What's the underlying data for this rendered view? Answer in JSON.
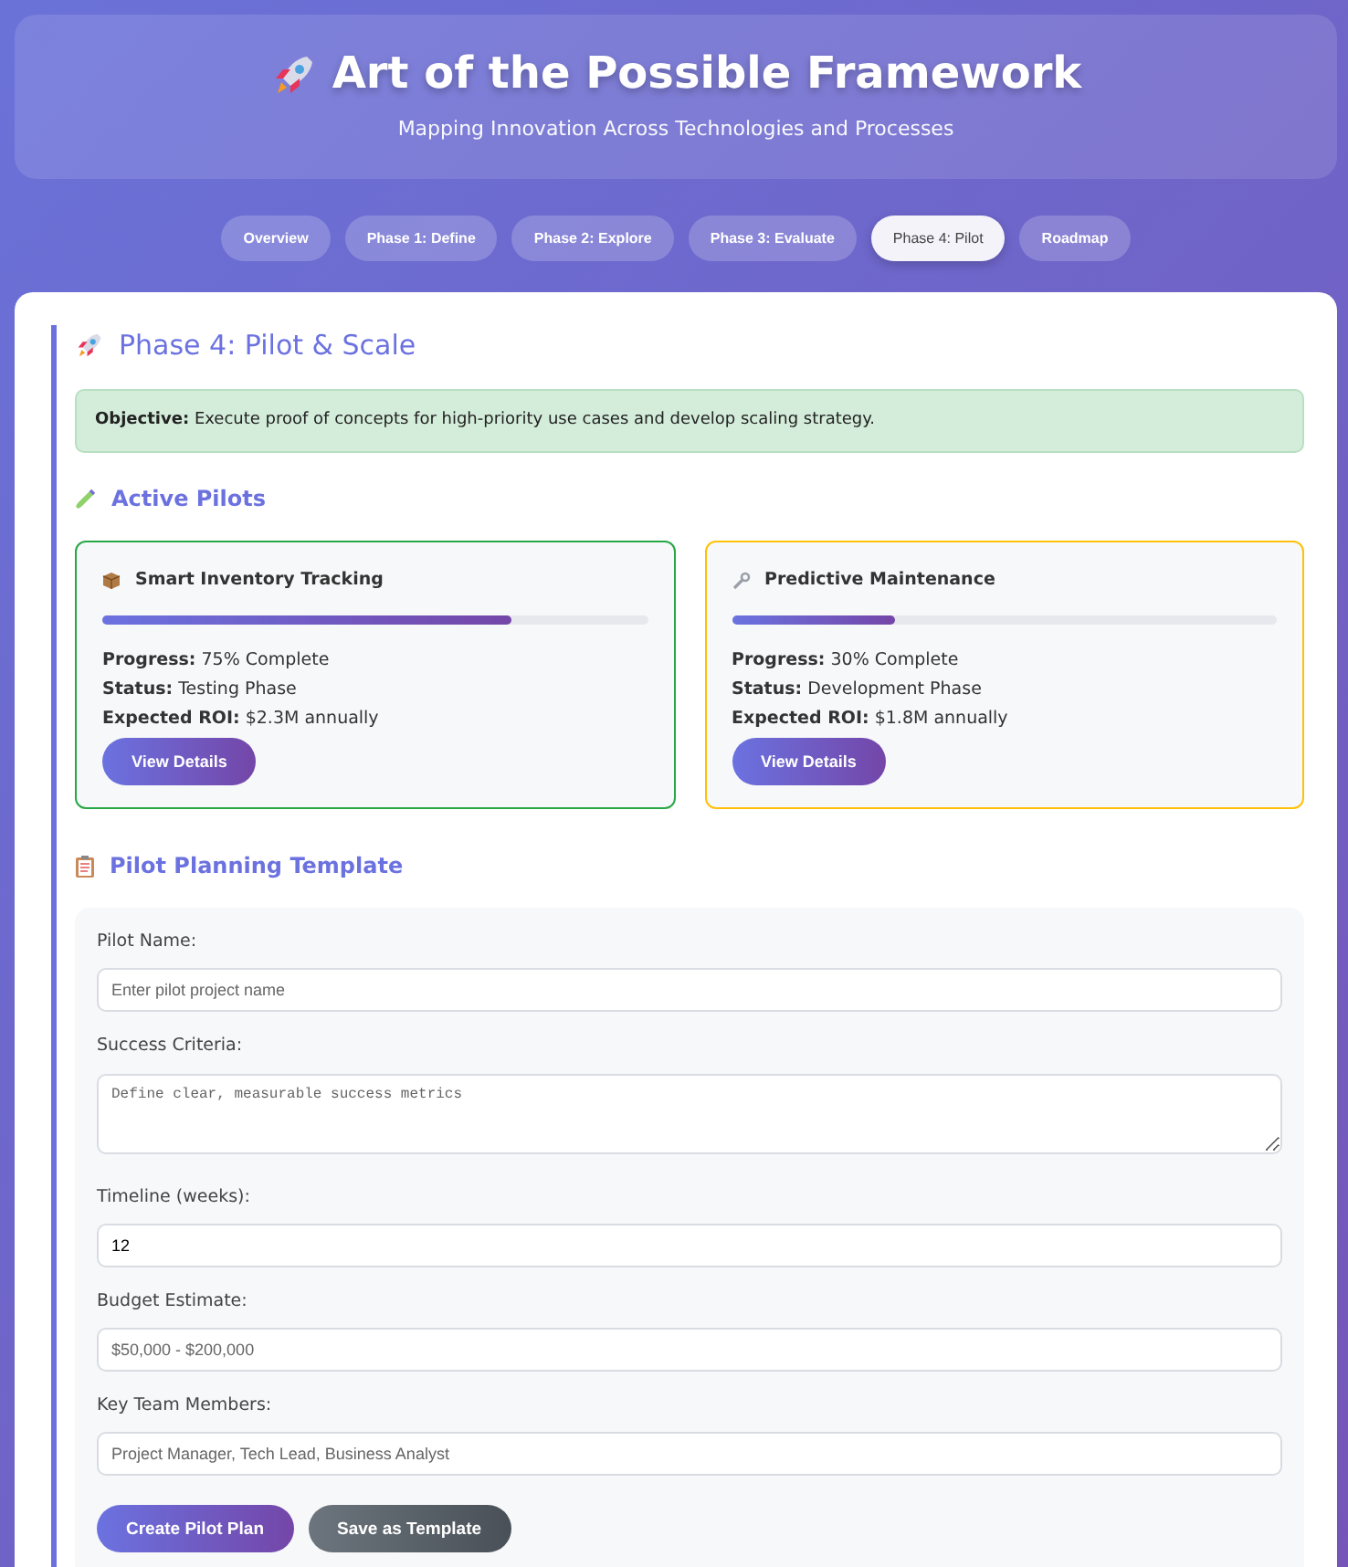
{
  "header": {
    "title": "Art of the Possible Framework",
    "subtitle": "Mapping Innovation Across Technologies and Processes"
  },
  "tabs": [
    {
      "label": "Overview",
      "selected": false
    },
    {
      "label": "Phase 1: Define",
      "selected": false
    },
    {
      "label": "Phase 2: Explore",
      "selected": false
    },
    {
      "label": "Phase 3: Evaluate",
      "selected": false
    },
    {
      "label": "Phase 4: Pilot",
      "selected": true
    },
    {
      "label": "Roadmap",
      "selected": false
    }
  ],
  "phase": {
    "title": "Phase 4: Pilot & Scale",
    "objective": "**Objective:** Execute proof of concepts for high-priority use cases and develop scaling strategy."
  },
  "active_pilots": {
    "title": "Active Pilots",
    "pilots": [
      {
        "kind": "box",
        "name": "Smart Inventory Tracking",
        "level": 0.75,
        "color": "#28a745",
        "lines": [
          "**Progress:** 75% Complete",
          "**Status:** Testing Phase",
          "**Expected ROI:** $2.3M annually"
        ],
        "button": "View Details"
      },
      {
        "kind": "wrench",
        "name": "Predictive Maintenance",
        "level": 0.3,
        "color": "#ffc107",
        "lines": [
          "**Progress:** 30% Complete",
          "**Status:** Development Phase",
          "**Expected ROI:** $1.8M annually"
        ],
        "button": "View Details"
      }
    ]
  },
  "template": {
    "title": "Pilot Planning Template",
    "fields": [
      {
        "kind": "input",
        "label": "Pilot Name:",
        "placeholder": "Enter pilot project name"
      },
      {
        "kind": "textarea",
        "label": "Success Criteria:",
        "placeholder": "Define clear, measurable success metrics"
      },
      {
        "kind": "input",
        "label": "Timeline (weeks):",
        "value": "12"
      },
      {
        "kind": "input",
        "label": "Budget Estimate:",
        "placeholder": "$50,000 - $200,000"
      },
      {
        "kind": "input",
        "label": "Key Team Members:",
        "placeholder": "Project Manager, Tech Lead, Business Analyst"
      }
    ],
    "buttons": [
      {
        "kind": "primary",
        "label": "Create Pilot Plan"
      },
      {
        "kind": "secondary",
        "label": "Save as Template"
      }
    ]
  }
}
